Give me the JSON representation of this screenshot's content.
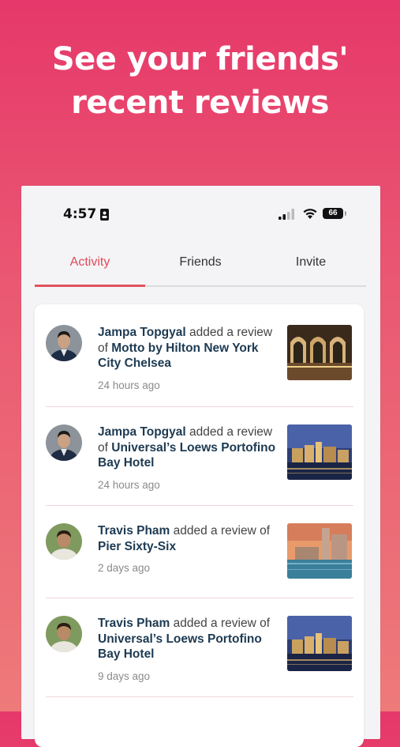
{
  "headline": {
    "line1": "See your friends'",
    "line2": "recent reviews"
  },
  "status_bar": {
    "time": "4:57",
    "battery": "66"
  },
  "tabs": [
    {
      "label": "Activity",
      "active": true
    },
    {
      "label": "Friends",
      "active": false
    },
    {
      "label": "Invite",
      "active": false
    }
  ],
  "activity": [
    {
      "user": "Jampa Topgyal",
      "action": "added a review of",
      "place": "Motto by Hilton New York City Chelsea",
      "time": "24 hours ago"
    },
    {
      "user": "Jampa Topgyal",
      "action": "added a review of",
      "place": "Universal’s Loews Portofino Bay Hotel",
      "time": "24 hours ago"
    },
    {
      "user": "Travis Pham",
      "action": "added a review of",
      "place": "Pier Sixty-Six",
      "time": "2 days ago"
    },
    {
      "user": "Travis Pham",
      "action": "added a review of",
      "place": "Universal’s Loews Portofino Bay Hotel",
      "time": "9 days ago"
    }
  ],
  "colors": {
    "accent": "#e0525d",
    "name": "#1d3a52",
    "background_top": "#e6386a",
    "background_bottom": "#ee7a7a"
  }
}
